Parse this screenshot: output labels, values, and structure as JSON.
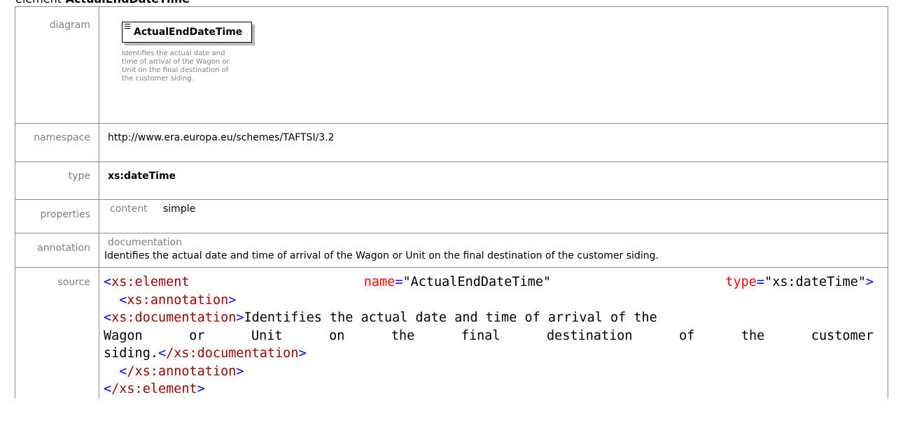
{
  "heading": {
    "kind": "element",
    "name": "ActualEndDateTime"
  },
  "labels": {
    "diagram": "diagram",
    "namespace": "namespace",
    "type": "type",
    "properties": "properties",
    "annotation": "annotation",
    "source": "source"
  },
  "diagram": {
    "element_name": "ActualEndDateTime",
    "description": "Identifies the actual date and time of arrival of the Wagon or Unit on the final destination of the customer siding."
  },
  "namespace": "http://www.era.europa.eu/schemes/TAFTSI/3.2",
  "type": "xs:dateTime",
  "properties": {
    "key": "content",
    "value": "simple"
  },
  "annotation": {
    "key": "documentation",
    "text": "Identifies the actual date and time of arrival of the Wagon or Unit on the final destination of the customer siding."
  },
  "source": {
    "open_tag": "xs:element",
    "attr_name": "name",
    "attr_name_value": "\"ActualEndDateTime\"",
    "attr_type": "type",
    "attr_type_value": "\"xs:dateTime\"",
    "annotation_tag": "xs:annotation",
    "documentation_tag": "xs:documentation",
    "doc_line1": "Identifies the actual date and time of arrival of the",
    "doc_line2_words": [
      "Wagon",
      "or",
      "Unit",
      "on",
      "the",
      "final",
      "destination",
      "of",
      "the",
      "customer"
    ],
    "doc_line3": "siding.",
    "close_documentation": "/xs:documentation",
    "close_annotation": "/xs:annotation",
    "close_element": "/xs:element"
  },
  "colors": {
    "tag": "#990000",
    "attribute": "#ff0000",
    "punctuation": "#0000ff",
    "label": "#808080",
    "border": "#8c8c8c"
  }
}
